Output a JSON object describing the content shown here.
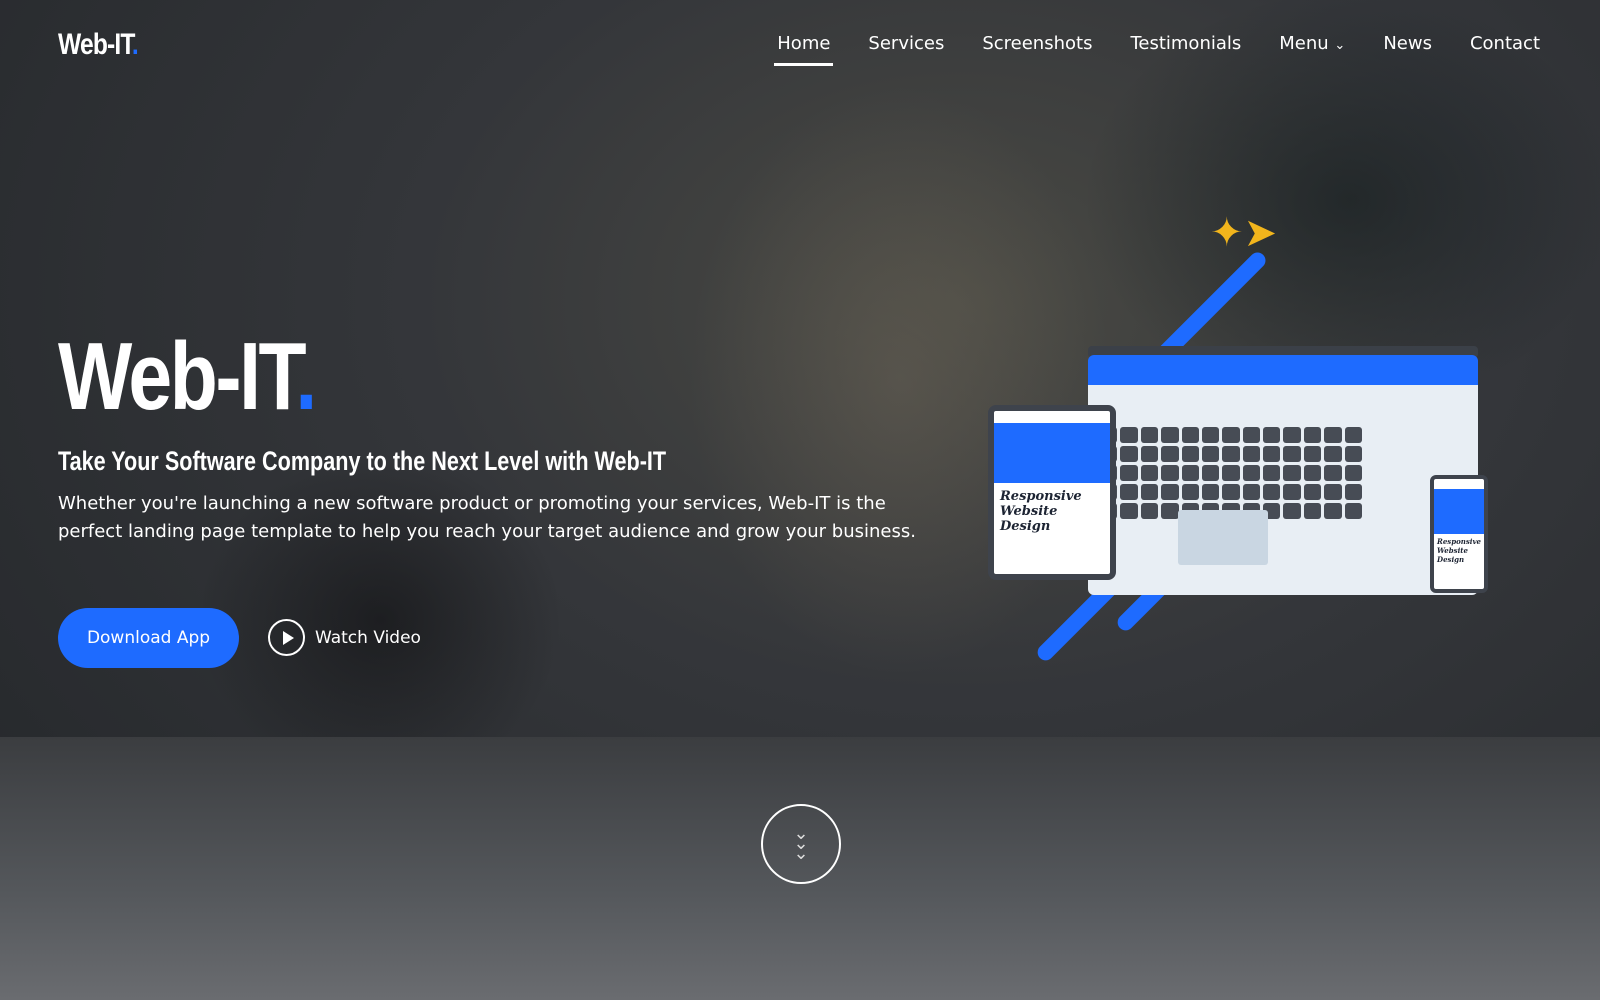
{
  "brand": {
    "name": "Web-IT",
    "dot": ".",
    "accent": "#1e6bff"
  },
  "nav": [
    {
      "label": "Home",
      "active": true
    },
    {
      "label": "Services"
    },
    {
      "label": "Screenshots"
    },
    {
      "label": "Testimonials"
    },
    {
      "label": "Menu",
      "icon": "chevron-down-icon"
    },
    {
      "label": "News"
    },
    {
      "label": "Contact"
    }
  ],
  "hero": {
    "title": "Web-IT",
    "title_dot": ".",
    "subtitle": "Take Your Software Company to the Next Level with Web-IT",
    "description": "Whether you're launching a new software product or promoting your services, Web-IT is the perfect landing page template to help you reach your target audience and grow your business.",
    "primary_button": "Download App",
    "secondary_button": "Watch Video"
  },
  "illustration": {
    "caption": "Responsive Website Design"
  },
  "scroll_icon": "chevrons-down-icon"
}
